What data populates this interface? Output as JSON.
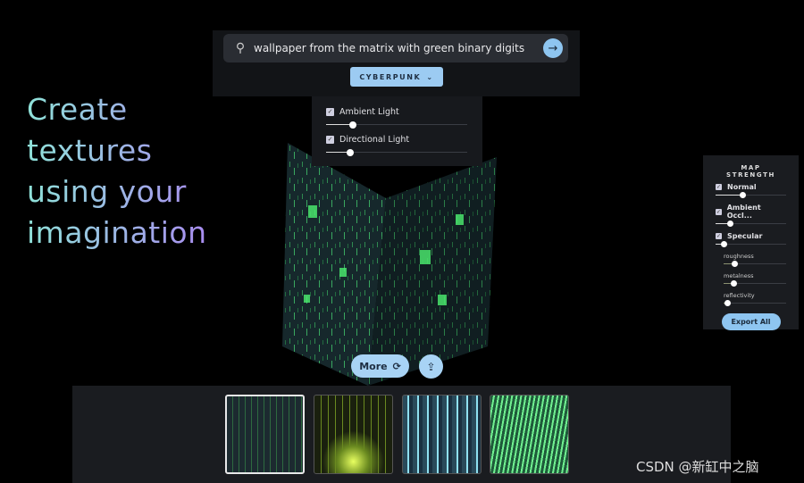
{
  "search": {
    "value": "wallpaper from the matrix with green binary digits",
    "icon": "search-icon",
    "submit_icon": "arrow-right-icon"
  },
  "style_dropdown": {
    "selected": "CYBERPUNK",
    "icon": "chevron-down-icon"
  },
  "lighting": {
    "items": [
      {
        "label": "Ambient Light",
        "checked": true,
        "value": 0.19
      },
      {
        "label": "Directional Light",
        "checked": true,
        "value": 0.17
      }
    ]
  },
  "headline": {
    "lines": [
      "Create",
      "textures",
      "using your",
      "imagination"
    ]
  },
  "map_strength": {
    "title": "MAP STRENGTH",
    "items": [
      {
        "label": "Normal",
        "checked": true,
        "value": 0.38
      },
      {
        "label": "Ambient Occl...",
        "checked": true,
        "value": 0.2
      },
      {
        "label": "Specular",
        "checked": true,
        "value": 0.11
      }
    ],
    "sub": [
      {
        "label": "roughness",
        "value": 0.17
      },
      {
        "label": "metalness",
        "value": 0.16
      },
      {
        "label": "reflectivity",
        "value": 0.06
      }
    ],
    "export_label": "Export All"
  },
  "actions": {
    "more_label": "More",
    "more_icon": "refresh-icon",
    "share_icon": "share-icon"
  },
  "thumbnails": [
    {
      "selected": true,
      "colors": [
        "#1c2a30",
        "#4be060"
      ]
    },
    {
      "selected": false,
      "colors": [
        "#1a200e",
        "#c8f040"
      ]
    },
    {
      "selected": false,
      "colors": [
        "#2a4a5a",
        "#8fe0f0"
      ]
    },
    {
      "selected": false,
      "colors": [
        "#1e5a3a",
        "#70f090"
      ]
    }
  ],
  "watermark": "CSDN @新缸中之脑"
}
